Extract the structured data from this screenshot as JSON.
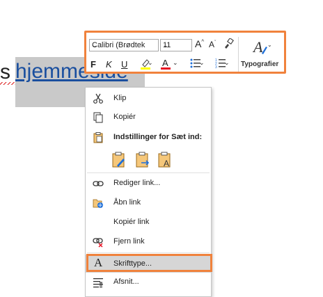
{
  "document": {
    "prefix_text": "s",
    "link_text": "hjemmeside"
  },
  "mini_toolbar": {
    "font_name": "Calibri (Brødtek",
    "font_size": "11",
    "grow_font": "A",
    "shrink_font": "A",
    "bold": "F",
    "italic": "K",
    "underline": "U",
    "highlight_color": "#ffff00",
    "font_color": "#e81123",
    "styles_label": "Typografier"
  },
  "context_menu": {
    "items": [
      {
        "label": "Klip"
      },
      {
        "label": "Kopiér"
      },
      {
        "label": "Indstillinger for Sæt ind:"
      },
      {
        "label": "Rediger link..."
      },
      {
        "label": "Åbn link"
      },
      {
        "label": "Kopiér link"
      },
      {
        "label": "Fjern link"
      },
      {
        "label": "Skrifttype..."
      },
      {
        "label": "Afsnit..."
      }
    ]
  },
  "colors": {
    "highlight_border": "#f0823c",
    "link_color": "#1a4f9f",
    "selection_bg": "#c9c9c9"
  }
}
